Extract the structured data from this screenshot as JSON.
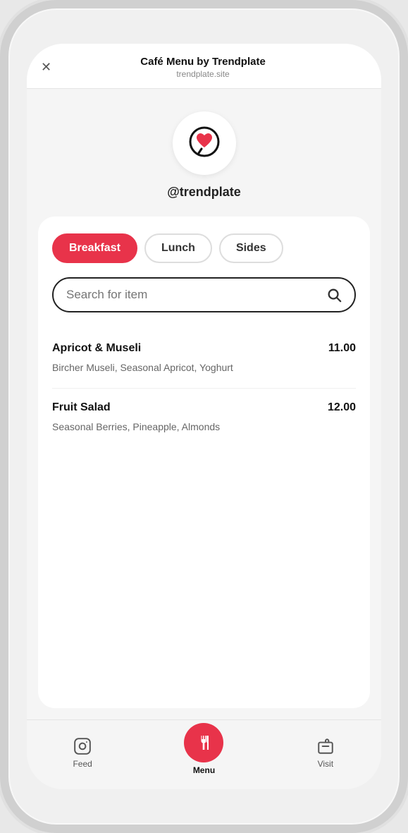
{
  "browser": {
    "title": "Café Menu by Trendplate",
    "url": "trendplate.site",
    "close_label": "✕"
  },
  "profile": {
    "username": "@trendplate"
  },
  "categories": [
    {
      "id": "breakfast",
      "label": "Breakfast",
      "active": true
    },
    {
      "id": "lunch",
      "label": "Lunch",
      "active": false
    },
    {
      "id": "sides",
      "label": "Sides",
      "active": false
    }
  ],
  "search": {
    "placeholder": "Search for item"
  },
  "menu_items": [
    {
      "name": "Apricot & Museli",
      "price": "11.00",
      "description": "Bircher Museli, Seasonal Apricot, Yoghurt"
    },
    {
      "name": "Fruit Salad",
      "price": "12.00",
      "description": "Seasonal Berries, Pineapple, Almonds"
    }
  ],
  "bottom_nav": [
    {
      "id": "feed",
      "label": "Feed",
      "active": false
    },
    {
      "id": "menu",
      "label": "Menu",
      "active": true
    },
    {
      "id": "visit",
      "label": "Visit",
      "active": false
    }
  ]
}
